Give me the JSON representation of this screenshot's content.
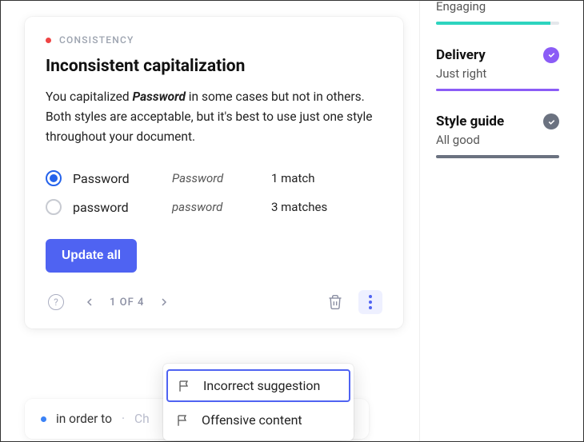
{
  "card": {
    "category": "CONSISTENCY",
    "title": "Inconsistent capitalization",
    "body_pre": "You capitalized ",
    "body_em": "Password",
    "body_post": " in some cases but not in others. Both styles are acceptable, but it's best to use just one style throughout your document.",
    "options": [
      {
        "label": "Password",
        "preview": "Password",
        "count": "1 match",
        "selected": true
      },
      {
        "label": "password",
        "preview": "password",
        "count": "3 matches",
        "selected": false
      }
    ],
    "cta": "Update all",
    "pager": "1 OF 4"
  },
  "menu": {
    "items": [
      {
        "label": "Incorrect suggestion",
        "active": true
      },
      {
        "label": "Offensive content",
        "active": false
      }
    ]
  },
  "stub": {
    "text": "in order to",
    "sep": "·",
    "trail": "Ch"
  },
  "sidebar": {
    "engaging_label": "Engaging",
    "metrics": [
      {
        "title": "Delivery",
        "sub": "Just right",
        "color": "purple"
      },
      {
        "title": "Style guide",
        "sub": "All good",
        "color": "gray"
      }
    ]
  }
}
